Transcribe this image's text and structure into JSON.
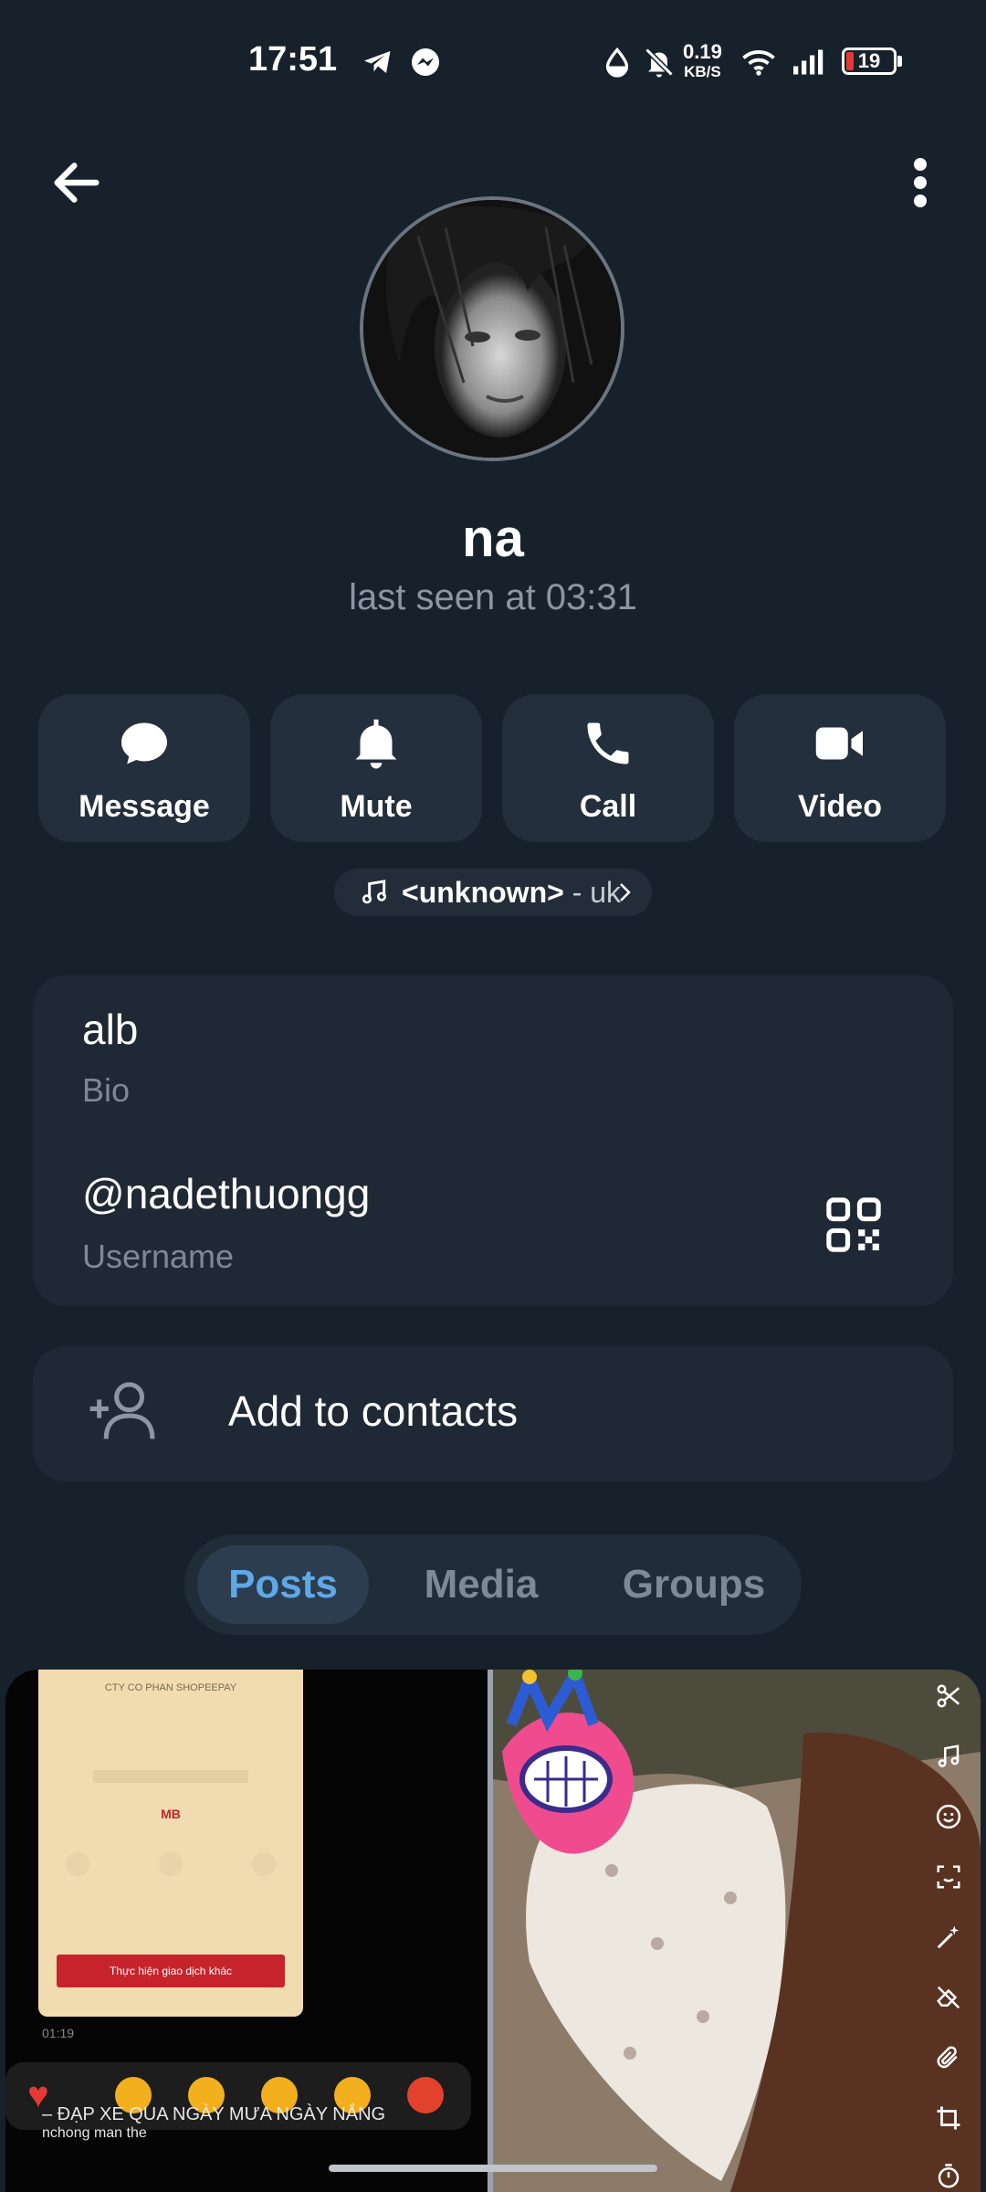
{
  "status_bar": {
    "time": "17:51",
    "speed_value": "0.19",
    "speed_unit": "KB/S",
    "battery": "19"
  },
  "profile": {
    "name": "na",
    "last_seen": "last seen at 03:31"
  },
  "actions": {
    "message": "Message",
    "mute": "Mute",
    "call": "Call",
    "video": "Video"
  },
  "music": {
    "title": "<unknown>",
    "separator": " - ",
    "artist": "uk"
  },
  "info": {
    "bio_value": "alb",
    "bio_label": "Bio",
    "username_value": "@nadethuongg",
    "username_label": "Username"
  },
  "add_contact": {
    "label": "Add to contacts"
  },
  "tabs": [
    {
      "label": "Posts",
      "active": true
    },
    {
      "label": "Media",
      "active": false
    },
    {
      "label": "Groups",
      "active": false
    }
  ],
  "media": {
    "post1": {
      "company": "CTY CO PHAN SHOPEEPAY",
      "bank": "MB",
      "button": "Thực hiện giao dịch khác",
      "duration": "01:19",
      "caption_line1": "– ĐẠP XE QUA NGÀY MƯA NGÀY NẮNG",
      "caption_line2": "nchong man the"
    }
  },
  "colors": {
    "background": "#17212b",
    "card": "#1f2935",
    "accent": "#5fa8e6",
    "muted_text": "#7e8994"
  }
}
